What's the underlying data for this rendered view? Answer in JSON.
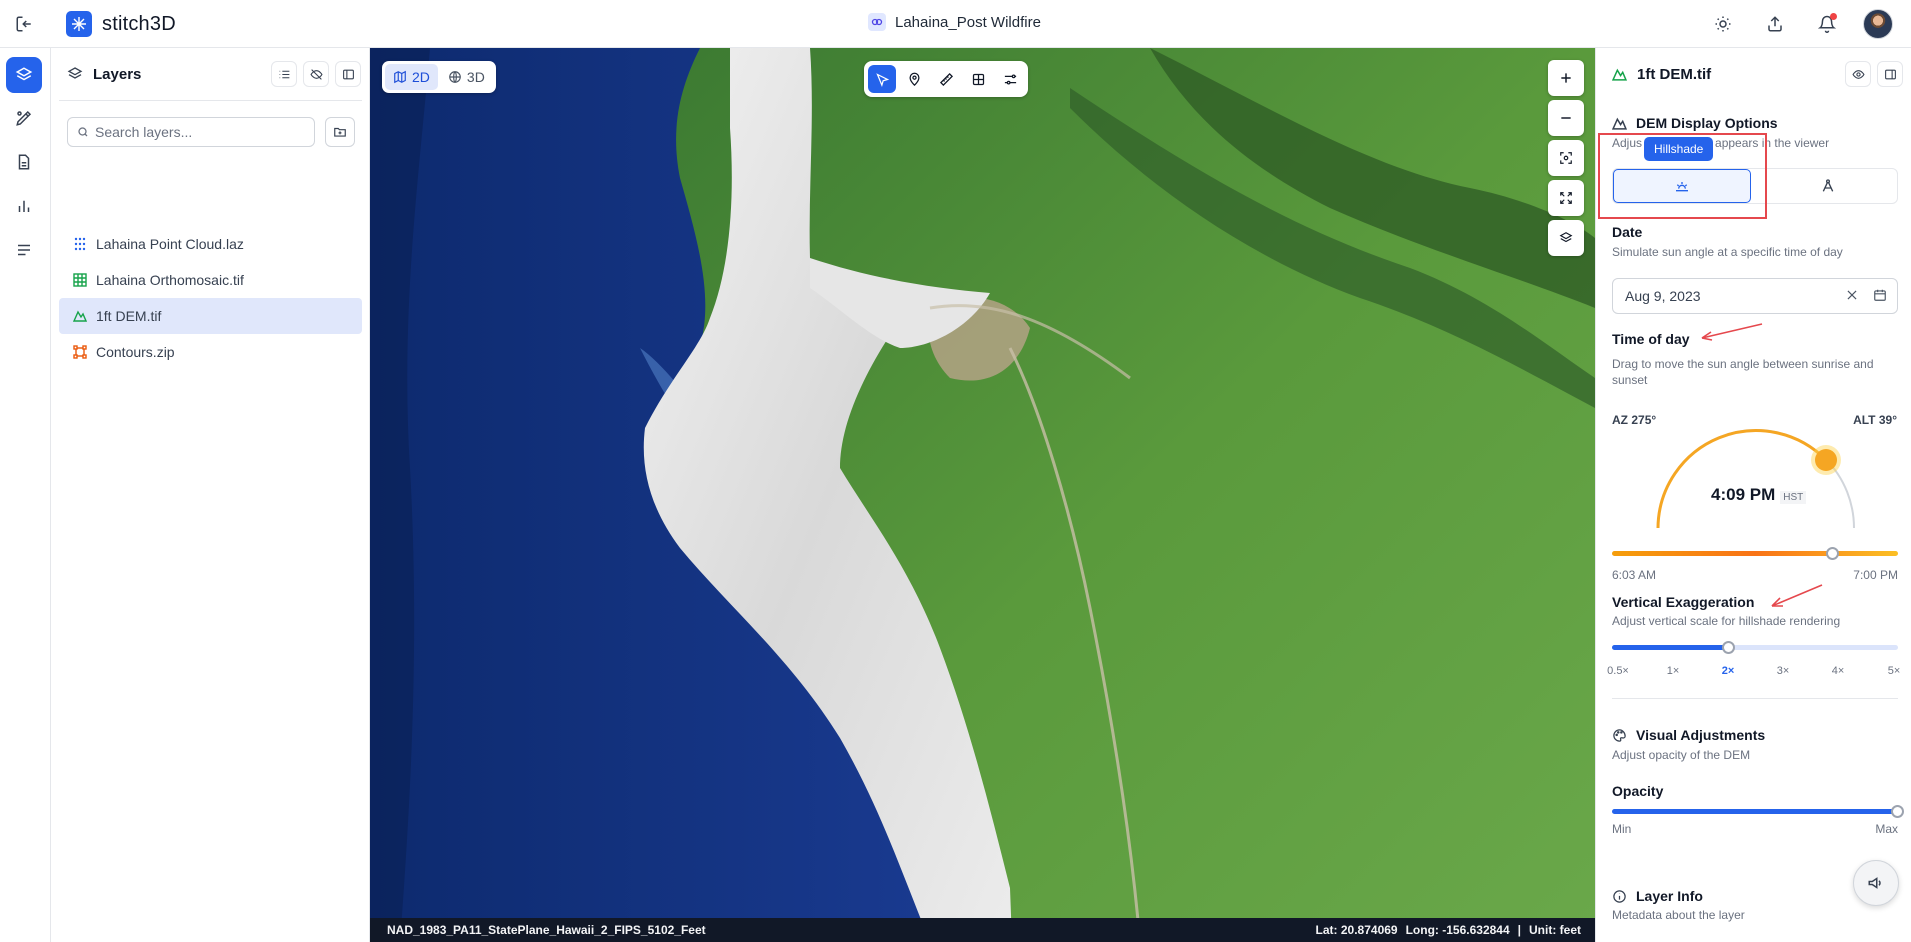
{
  "app": {
    "brand": "stitch3D",
    "project_title": "Lahaina_Post Wildfire"
  },
  "layers_panel": {
    "title": "Layers",
    "search_placeholder": "Search layers...",
    "items": [
      {
        "label": "Lahaina Point Cloud.laz",
        "icon": "point-cloud-icon",
        "color": "#2563eb",
        "selected": false
      },
      {
        "label": "Lahaina Orthomosaic.tif",
        "icon": "raster-grid-icon",
        "color": "#16a34a",
        "selected": false
      },
      {
        "label": "1ft DEM.tif",
        "icon": "terrain-icon",
        "color": "#16a34a",
        "selected": true
      },
      {
        "label": "Contours.zip",
        "icon": "vector-shape-icon",
        "color": "#ea580c",
        "selected": false
      }
    ]
  },
  "map": {
    "view_modes": [
      {
        "label": "2D",
        "active": true
      },
      {
        "label": "3D",
        "active": false
      }
    ],
    "crs": "NAD_1983_PA11_StatePlane_Hawaii_2_FIPS_5102_Feet",
    "lat": "Lat: 20.874069",
    "long": "Long: -156.632844",
    "separator": "|",
    "unit": "Unit: feet"
  },
  "properties": {
    "layer_title": "1ft DEM.tif",
    "dem_section": {
      "title": "DEM Display Options",
      "subtitle_left": "Adjus",
      "subtitle_right": "appears in the viewer"
    },
    "tooltip": "Hillshade",
    "date": {
      "label": "Date",
      "subtitle": "Simulate sun angle at a specific time of day",
      "value": "Aug 9, 2023"
    },
    "time_of_day": {
      "label": "Time of day",
      "subtitle": "Drag to move the sun angle between sunrise and sunset",
      "az_label": "AZ",
      "az_value": "275°",
      "alt_label": "ALT",
      "alt_value": "39°",
      "time": "4:09 PM",
      "tz": "HST",
      "start": "6:03 AM",
      "end": "7:00 PM",
      "progress": 0.77
    },
    "vertical_exaggeration": {
      "label": "Vertical Exaggeration",
      "subtitle": "Adjust vertical scale for hillshade rendering",
      "ticks": [
        "0.5×",
        "1×",
        "2×",
        "3×",
        "4×",
        "5×"
      ],
      "selected": "2×"
    },
    "visual_adjustments": {
      "title": "Visual Adjustments",
      "subtitle": "Adjust opacity of the DEM"
    },
    "opacity": {
      "label": "Opacity",
      "min": "Min",
      "max": "Max",
      "value": 1.0
    },
    "layer_info": {
      "title": "Layer Info",
      "subtitle": "Metadata about the layer"
    }
  },
  "colors": {
    "accent": "#2563eb",
    "sun": "#f5a623",
    "annotation": "#e5484d"
  }
}
